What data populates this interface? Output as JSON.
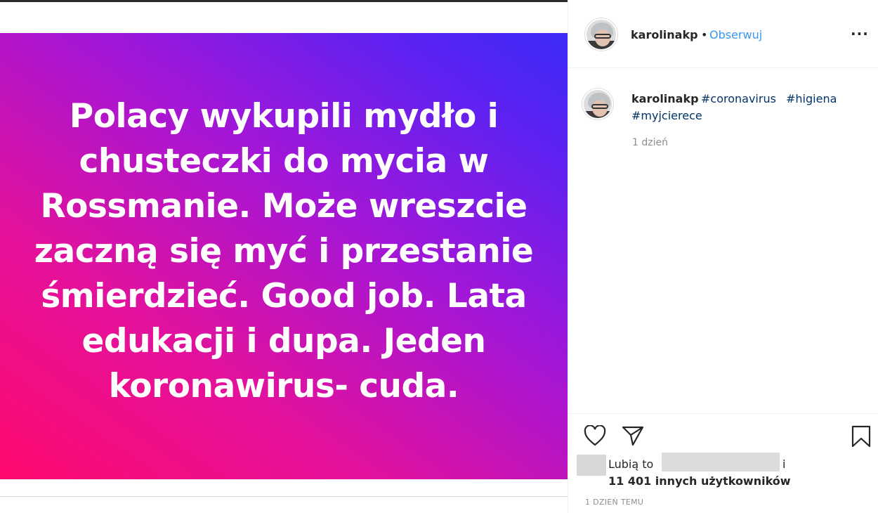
{
  "post": {
    "image_text": "Polacy wykupili mydło  i chusteczki do mycia w Rossmanie. Może wreszcie zaczną się myć i przestanie śmierdzieć. Good job. Lata edukacji i dupa. Jeden koronawirus- cuda."
  },
  "header": {
    "username": "karolinakp",
    "separator": "•",
    "follow_label": "Obserwuj",
    "more_label": "···"
  },
  "caption": {
    "username": "karolinakp",
    "hashtags": [
      "#coronavirus",
      "#higiena",
      "#myjcierece"
    ],
    "time": "1 dzień"
  },
  "likes": {
    "prefix": "Lubią to",
    "suffix": "i",
    "others": "11 401 innych użytkowników"
  },
  "post_time": "1 DZIEŃ TEMU",
  "colors": {
    "link": "#3897f0",
    "hashtag": "#003569",
    "gradient_start": "#ff0a6e",
    "gradient_end": "#3c2bf6"
  }
}
